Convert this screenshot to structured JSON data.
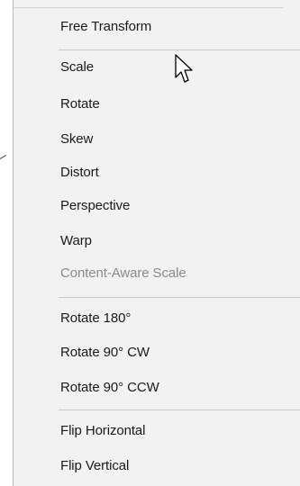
{
  "menu": {
    "items": [
      {
        "label": "Free Transform",
        "enabled": true
      },
      {
        "label": "Scale",
        "enabled": true
      },
      {
        "label": "Rotate",
        "enabled": true
      },
      {
        "label": "Skew",
        "enabled": true
      },
      {
        "label": "Distort",
        "enabled": true
      },
      {
        "label": "Perspective",
        "enabled": true
      },
      {
        "label": "Warp",
        "enabled": true
      },
      {
        "label": "Content-Aware Scale",
        "enabled": false
      },
      {
        "label": "Rotate 180°",
        "enabled": true
      },
      {
        "label": "Rotate 90° CW",
        "enabled": true
      },
      {
        "label": "Rotate 90° CCW",
        "enabled": true
      },
      {
        "label": "Flip Horizontal",
        "enabled": true
      },
      {
        "label": "Flip Vertical",
        "enabled": true
      }
    ]
  },
  "colors": {
    "menu_background": "#f2f2f2",
    "text": "#1a1a1a",
    "disabled_text": "#8a8a8a",
    "separator": "#c8c8c8"
  },
  "icons": {
    "cursor": "arrow-cursor-icon"
  }
}
